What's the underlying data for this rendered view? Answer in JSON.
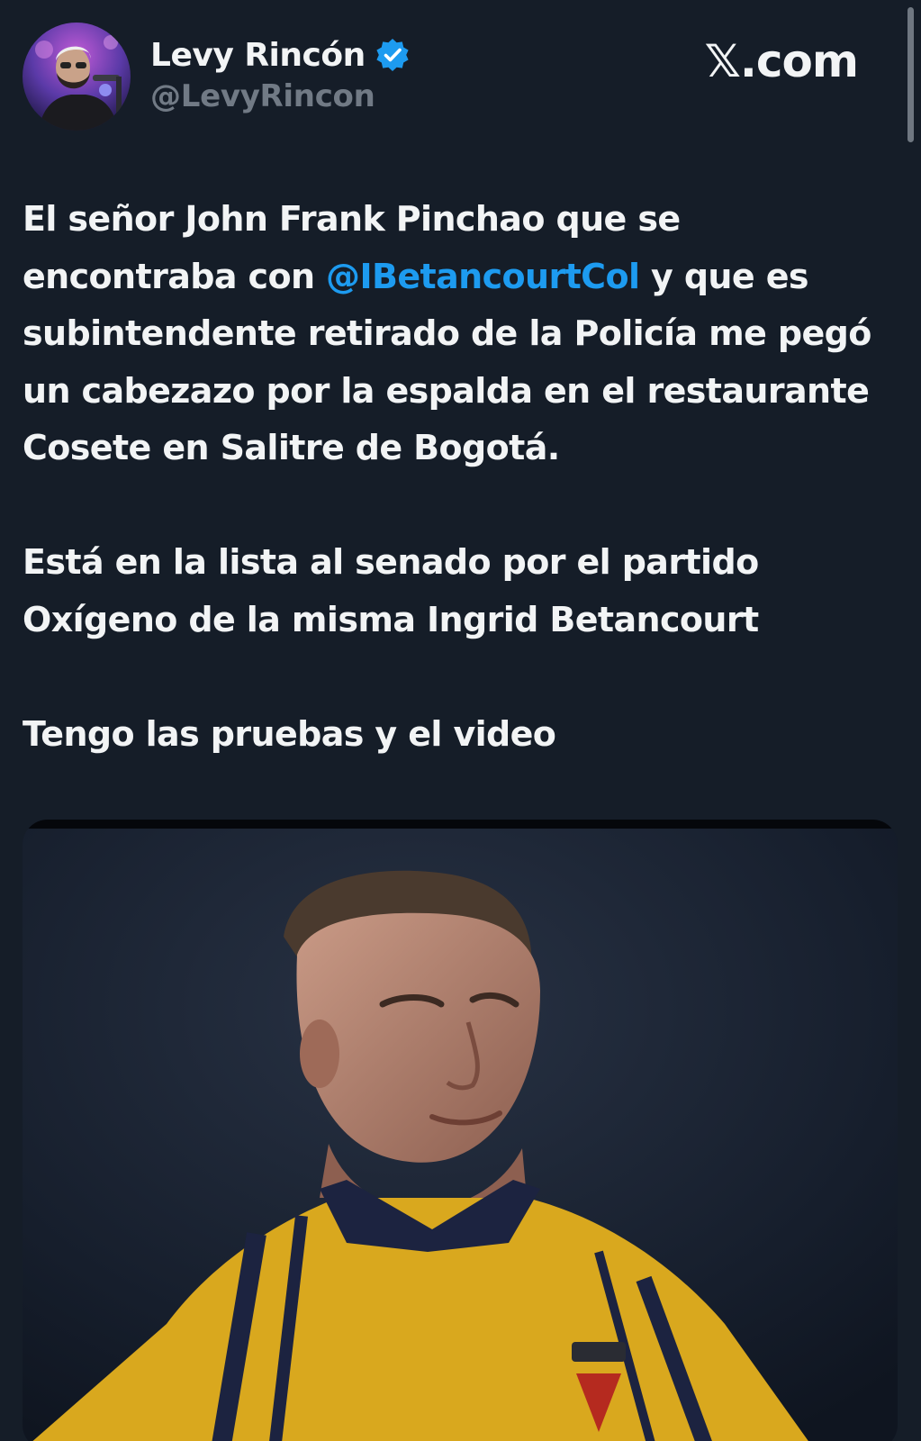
{
  "author": {
    "display_name": "Levy Rincón",
    "handle": "@LevyRincon",
    "verified": true
  },
  "brand": "𝕏.com",
  "tweet": {
    "p1_before": "El señor John Frank Pinchao que se encontraba con ",
    "mention": "@IBetancourtCol",
    "p1_after": "  y que es subintendente retirado de la Policía me pegó un cabezazo por la espalda en el restaurante Cosete en Salitre de Bogotá.",
    "p2": "Está en la lista al senado por el partido Oxígeno de la misma Ingrid Betancourt",
    "p3": "Tengo las pruebas y el video"
  },
  "colors": {
    "background": "#151d28",
    "text": "#f2f4f5",
    "handle": "#717a85",
    "mention": "#1d9bf0",
    "verified_badge": "#1d9bf0"
  },
  "icons": {
    "verified": "verified-badge-icon",
    "avatar": "profile-photo"
  }
}
